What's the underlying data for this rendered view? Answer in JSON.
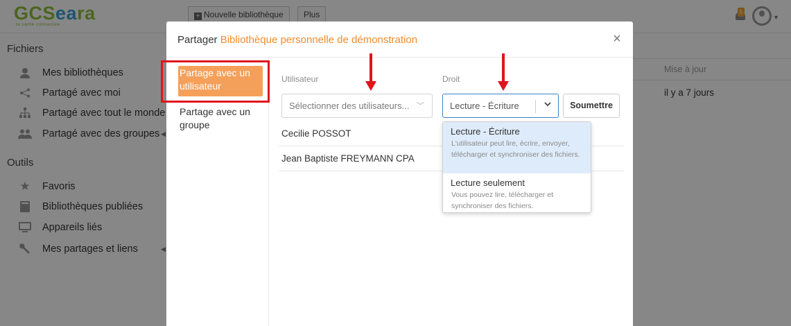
{
  "app": {
    "logo_text": "GCSeara",
    "logo_tagline": "la santé connectée",
    "toolbar": {
      "new_library_label": "Nouvelle bibliothèque",
      "more_label": "Plus"
    },
    "notification_count": "5"
  },
  "sidebar": {
    "files_heading": "Fichiers",
    "files_items": [
      {
        "label": "Mes bibliothèques",
        "icon": "user-icon"
      },
      {
        "label": "Partagé avec moi",
        "icon": "share-icon"
      },
      {
        "label": "Partagé avec tout le monde",
        "icon": "org-icon"
      },
      {
        "label": "Partagé avec des groupes",
        "icon": "group-icon"
      }
    ],
    "tools_heading": "Outils",
    "tools_items": [
      {
        "label": "Favoris",
        "icon": "star-icon"
      },
      {
        "label": "Bibliothèques publiées",
        "icon": "book-icon"
      },
      {
        "label": "Appareils liés",
        "icon": "monitor-icon"
      },
      {
        "label": "Mes partages et liens",
        "icon": "wrench-icon"
      }
    ]
  },
  "main": {
    "column_header": "Mise à jour",
    "row_updated": "il y a 7 jours"
  },
  "modal": {
    "title_prefix": "Partager",
    "library_name": "Bibliothèque personnelle de démonstration",
    "close_symbol": "×",
    "nav": [
      {
        "label": "Partage avec un utilisateur",
        "active": true
      },
      {
        "label": "Partage avec un groupe",
        "active": false
      }
    ],
    "user_column_label": "Utilisateur",
    "permission_column_label": "Droit",
    "user_select_placeholder": "Sélectionner des utilisateurs...",
    "permission_selected": "Lecture - Écriture",
    "submit_label": "Soumettre",
    "shared_users": [
      "Cecilie POSSOT",
      "Jean Baptiste FREYMANN CPA"
    ],
    "permission_options": [
      {
        "title": "Lecture - Écriture",
        "description": "L'utilisateur peut lire, écrire, envoyer, télécharger et synchroniser des fichiers.",
        "highlighted": true
      },
      {
        "title": "Lecture seulement",
        "description": "Vous pouvez lire, télécharger et synchroniser des fichiers.",
        "highlighted": false
      }
    ]
  },
  "colors": {
    "accent_orange": "#f08c2c",
    "active_nav_bg": "#f5a05a",
    "annotation_red": "#e0141b",
    "focus_blue": "#3b82c4"
  }
}
